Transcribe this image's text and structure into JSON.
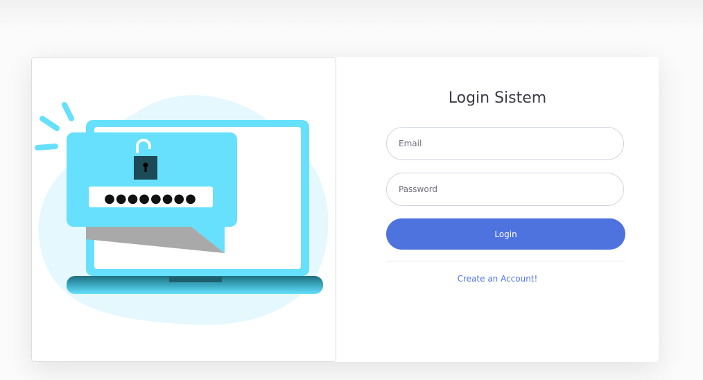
{
  "login": {
    "title": "Login Sistem",
    "email_placeholder": "Email",
    "password_placeholder": "Password",
    "submit_label": "Login",
    "create_account_label": "Create an Account!"
  },
  "illustration": {
    "description_icon": "laptop-password-unlock-illustration",
    "password_mask": "●●●●●●●●"
  },
  "colors": {
    "accent": "#4e73df",
    "illustration_blue": "#66e0fc",
    "illustration_bg": "#e4f8fe"
  }
}
